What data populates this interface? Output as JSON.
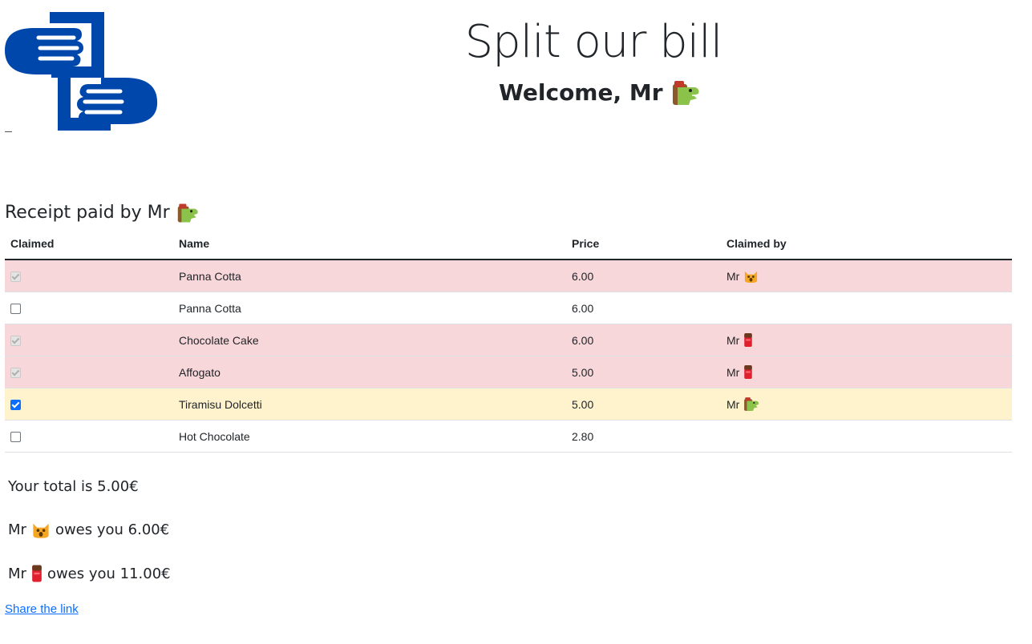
{
  "header": {
    "logo_icon": "hands-exchange-logo",
    "app_title": "Split our bill",
    "welcome_prefix": "Welcome, Mr",
    "welcome_emoji": "dragon-emoji"
  },
  "receipt": {
    "title_prefix": "Receipt paid by Mr",
    "title_emoji": "dragon-emoji",
    "columns": [
      "Claimed",
      "Name",
      "Price",
      "Claimed by"
    ],
    "rows": [
      {
        "claimed": true,
        "mine": false,
        "name": "Panna Cotta",
        "price": "6.00",
        "claimed_by": "Mr",
        "claimer_emoji": "cat-emoji"
      },
      {
        "claimed": false,
        "mine": false,
        "name": "Panna Cotta",
        "price": "6.00",
        "claimed_by": "",
        "claimer_emoji": ""
      },
      {
        "claimed": true,
        "mine": false,
        "name": "Chocolate Cake",
        "price": "6.00",
        "claimed_by": "Mr",
        "claimer_emoji": "chocolate-bar-emoji"
      },
      {
        "claimed": true,
        "mine": false,
        "name": "Affogato",
        "price": "5.00",
        "claimed_by": "Mr",
        "claimer_emoji": "chocolate-bar-emoji"
      },
      {
        "claimed": true,
        "mine": true,
        "name": "Tiramisu Dolcetti",
        "price": "5.00",
        "claimed_by": "Mr",
        "claimer_emoji": "dragon-emoji"
      },
      {
        "claimed": false,
        "mine": false,
        "name": "Hot Chocolate",
        "price": "2.80",
        "claimed_by": "",
        "claimer_emoji": ""
      }
    ]
  },
  "summary": {
    "total_text": "Your total is 5.00€",
    "debts": [
      {
        "prefix": "Mr",
        "emoji": "cat-emoji",
        "text": "owes you 6.00€"
      },
      {
        "prefix": "Mr",
        "emoji": "chocolate-bar-emoji",
        "text": "owes you 11.00€"
      }
    ]
  },
  "share": {
    "link_label": "Share the link"
  },
  "colors": {
    "logo_blue": "#0047AB",
    "claimed_row": "#f8d7da",
    "my_claim_row": "#fff3cd",
    "link": "#0d6efd"
  }
}
